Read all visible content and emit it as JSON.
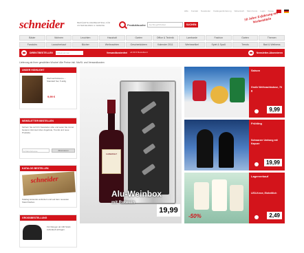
{
  "top_links": [
    "Hilfe",
    "Kontakt",
    "Newsletter",
    "Kataloganforderung",
    "Warenkorb",
    "Mein Konto",
    "Login",
    "Kasse"
  ],
  "brand": {
    "name": "schneider",
    "tagline": "BEWÄHRTE WERBEARTIKEL FÜR UNTERNEHMEN & VEREINE"
  },
  "search": {
    "label": "Produktsuche",
    "placeholder": "Suchbegriff/Artikel",
    "button": "SUCHEN"
  },
  "promo": {
    "text": "50 Jahre Erfahrung mit Werbemitteln"
  },
  "nav_row1": [
    "Bäder",
    "Wohnen",
    "Leuchten",
    "Haushalt",
    "Garten",
    "Office & Technik",
    "Lambarde",
    "Fashion",
    "Garten",
    "Themen"
  ],
  "nav_row2": [
    "Fanclubs",
    "Lauscherkauf",
    "Bücher",
    "Weihnachten",
    "Geschenkideen",
    "Kalender 2011",
    "Werbeartikel",
    "Spiel & Spaß",
    "Trends",
    "Bad & Wellness"
  ],
  "redbar": {
    "label": "DIREKTBESTELLEN",
    "input_placeholder": "Artikelnummer",
    "offer_title": "Versandkostenfrei",
    "offer_text": "ab 99 € Bestellwert",
    "newsletter": "Newsletter-Abonnieren"
  },
  "intro_text": "Lieferung ab Ihrer gewählten Woche! Alle Preise inkl. MwSt. und Versandkosten",
  "sidebar": {
    "box1": {
      "title": "UNSER HIGHLIGHT",
      "text": "Weihnachtsbäume – Standard Set, 5-teilig",
      "price": "9,99 €"
    },
    "box2": {
      "title": "NEWSLETTER BESTELLEN",
      "text": "Sichern Sie sich Ihr Newsletter-Abo und seien Sie immer bestens informiert über Angebote, Trends und neue Produkte.",
      "input_placeholder": "E-Mail-Adresse",
      "button": "Abonnieren"
    },
    "box3": {
      "title": "KATALOG BESTELLEN",
      "text": "Katalog kostenlos anfordern und auf dem neuesten Stand bleiben.",
      "catalog_brand": "schneider"
    },
    "box4": {
      "title": "GROSSBESTELLUNG",
      "text": "Für Mengen ab 100 Stück individuell anfragen."
    }
  },
  "hero": {
    "title": "Alu-Weinbox",
    "subtitle": "mit Rotwein",
    "price": "19,99",
    "label": "CABERNET"
  },
  "deals": [
    {
      "category": "Saison",
      "desc": "Große Weihnachtsdose, 78 g",
      "price": "9,99"
    },
    {
      "category": "Frühling",
      "desc": "Schwarzer Umhang mit Kapuze",
      "price": "19,99"
    },
    {
      "category": "Lagerverkauf",
      "desc": "LED-Kerze, Einheitlich",
      "price": "2,49",
      "discount": "-50%"
    }
  ],
  "colors": {
    "brand_red": "#d3141b",
    "nav_gray": "#ececec"
  }
}
